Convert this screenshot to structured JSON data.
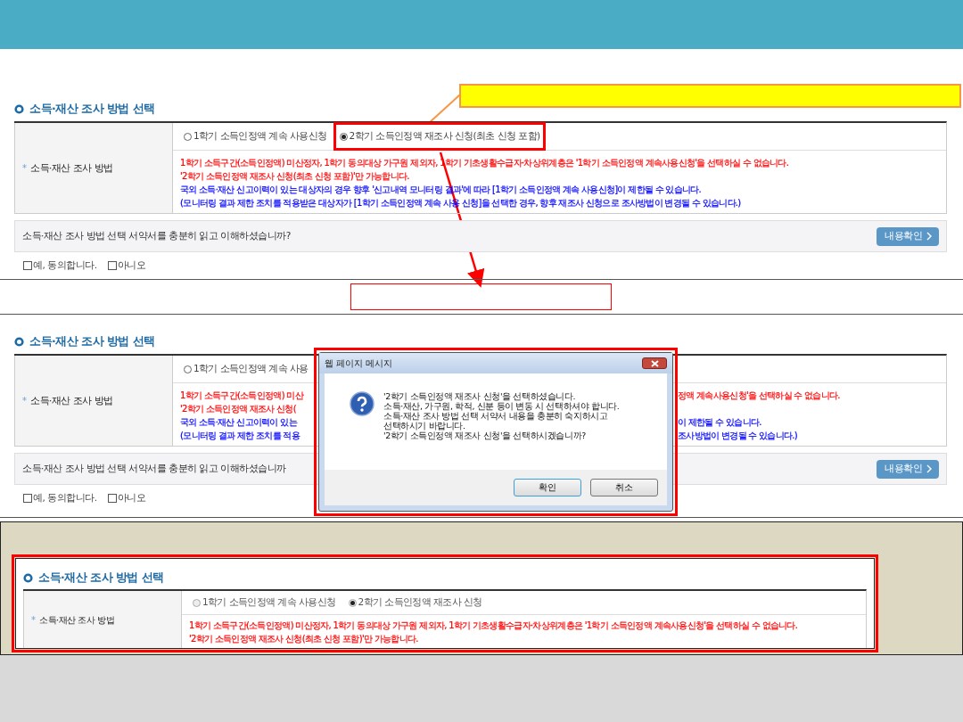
{
  "form_before": {
    "title": "소득·재산 조사 방법 선택",
    "required_mark": "*",
    "field_label": "소득·재산 조사 방법",
    "options": [
      {
        "label": "1학기 소득인정액 계속 사용신청",
        "selected": false,
        "highlighted": false
      },
      {
        "label": "2학기 소득인정액 재조사 신청(최초 신청 포함)",
        "selected": true,
        "highlighted": true
      }
    ],
    "notes": [
      {
        "text": "1학기 소득구간(소득인정액) 미산정자, 1학기 동의대상 가구원 제외자, 1학기 기초생활수급자·차상위계층은 '1학기 소득인정액 계속사용신청'을 선택하실 수 없습니다.",
        "kind": "warning"
      },
      {
        "text": "'2학기 소득인정액 재조사 신청(최초 신청 포함)'만 가능합니다.",
        "kind": "warning"
      },
      {
        "text": "국외 소득·재산 신고이력이 있는 대상자의 경우 향후 '신고내역 모니터링 결과'에 따라 [1학기 소득인정액 계속 사용신청]이 제한될 수 있습니다.",
        "kind": "info"
      },
      {
        "text": "(모니터링 결과 제한 조치를 적용받은 대상자가 [1학기 소득인정액 계속 사용 신청]을 선택한 경우, 향후 재조사 신청으로 조사방법이 변경될 수 있습니다.)",
        "kind": "info"
      }
    ],
    "agreement": {
      "question": "소득·재산 조사 방법 선택 서약서를 충분히 읽고 이해하셨습니까?",
      "button": "내용확인",
      "checkboxes": [
        {
          "label": "예, 동의합니다.",
          "checked": false
        },
        {
          "label": "아니오",
          "checked": false
        }
      ]
    }
  },
  "form_with_dialog": {
    "title": "소득·재산 조사 방법 선택",
    "required_mark": "*",
    "field_label": "소득·재산 조사 방법",
    "options": [
      {
        "label": "1학기 소득인정액 계속 사용",
        "selected": false,
        "highlighted": false
      }
    ],
    "notes": [
      {
        "text": "1학기 소득구간(소득인정액) 미산",
        "after": "정액 계속사용신청'을 선택하실 수 없습니다.",
        "kind": "warning"
      },
      {
        "text": "'2학기 소득인정액 재조사 신청(",
        "kind": "warning"
      },
      {
        "text": "국외 소득·재산 신고이력이 있는",
        "after": "이 제한될 수 있습니다.",
        "kind": "info"
      },
      {
        "text": "(모니터링 결과 제한 조치를 적용",
        "after": "조사방법이 변경될 수 있습니다.)",
        "kind": "info"
      }
    ],
    "agreement": {
      "question": "소득·재산 조사 방법 선택 서약서를 충분히 읽고 이해하셨습니까",
      "button": "내용확인",
      "checkboxes": [
        {
          "label": "예, 동의합니다.",
          "checked": false
        },
        {
          "label": "아니오",
          "checked": false
        }
      ]
    },
    "dialog": {
      "title": "웹 페이지 메시지",
      "lines": [
        "'2학기 소득인정액 재조사 신청'을 선택하셨습니다.",
        "소득·재산, 가구원, 학적, 신분 등이 변동 시 선택하셔야 합니다.",
        "소득·재산 조사 방법 선택 서약서 내용을 충분히 숙지하시고",
        "선택하시기 바랍니다.",
        "'2학기 소득인정액 재조사 신청'을 선택하시겠습니까?"
      ],
      "buttons": [
        "확인",
        "취소"
      ]
    }
  },
  "form_after": {
    "title": "소득·재산 조사 방법 선택",
    "required_mark": "*",
    "field_label": "소득·재산 조사 방법",
    "options": [
      {
        "label": "1학기 소득인정액 계속 사용신청",
        "selected": false,
        "highlighted": false
      },
      {
        "label": "2학기 소득인정액 재조사 신청",
        "selected": true,
        "highlighted": false
      }
    ],
    "notes": [
      {
        "text": "1학기 소득구간(소득인정액) 미산정자, 1학기 동의대상 가구원 제외자, 1학기 기초생활수급자·차상위계층은 '1학기 소득인정액 계속사용신청'을 선택하실 수 없습니다.",
        "kind": "warning"
      },
      {
        "text": "'2학기 소득인정액 재조사 신청(최초 신청 포함)'만 가능합니다.",
        "kind": "warning"
      }
    ]
  }
}
